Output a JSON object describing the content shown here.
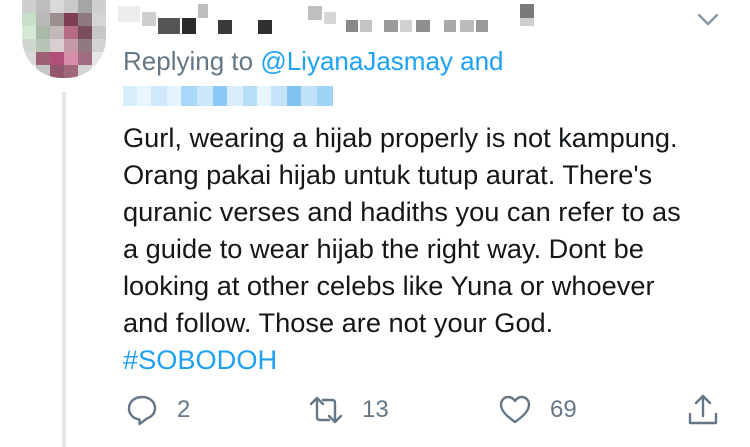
{
  "tweet": {
    "replying_prefix": "Replying to",
    "replying_mention": "@LiyanaJasmay",
    "replying_suffix": "and",
    "text_lines": [
      "Gurl, wearing a hijab properly is not kampung.",
      "Orang pakai hijab untuk tutup aurat. There's",
      "quranic verses and hadiths you can refer to as",
      "a guide to wear hijab the right way. Dont be",
      "looking at other celebs like Yuna or whoever",
      "and follow. Those are not your God."
    ],
    "hashtag": "#SOBODOH"
  },
  "actions": {
    "reply": {
      "icon": "reply-icon",
      "count": "2"
    },
    "retweet": {
      "icon": "retweet-icon",
      "count": "13"
    },
    "like": {
      "icon": "heart-icon",
      "count": "69"
    },
    "share": {
      "icon": "share-icon"
    }
  },
  "header": {
    "menu_icon": "chevron-down-icon"
  },
  "colors": {
    "link": "#1da1f2",
    "secondary_text": "#657786",
    "primary_text": "#14171a",
    "thread_line": "#e1e8ed"
  }
}
